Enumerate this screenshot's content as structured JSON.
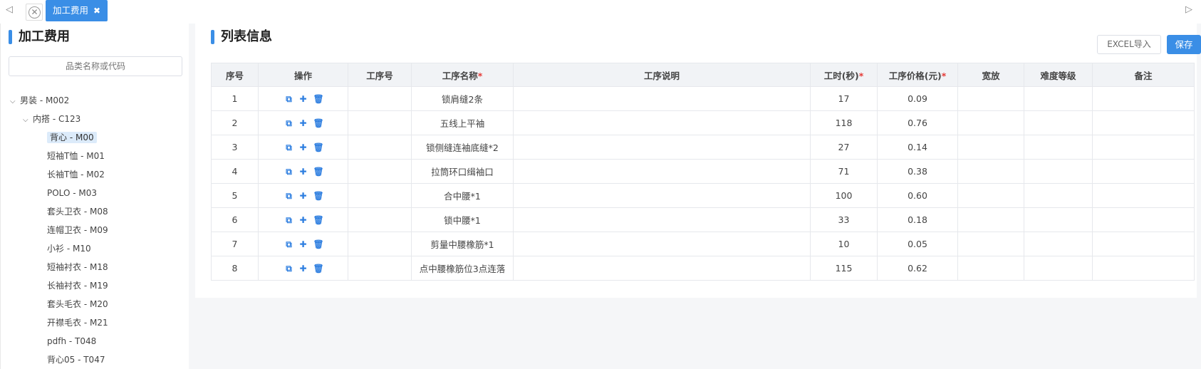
{
  "tabbar": {
    "active_tab_label": "加工费用",
    "active_tab_close": "✖",
    "close_all_glyph": "✕",
    "nav_left_glyph": "◁",
    "nav_right_glyph": "▷"
  },
  "left": {
    "title": "加工费用",
    "search_placeholder": "品类名称或代码",
    "tree": [
      {
        "label": "男装 - M002",
        "level": 0,
        "expanded": true
      },
      {
        "label": "内搭 - C123",
        "level": 1,
        "expanded": true
      },
      {
        "label": "背心 - M00",
        "level": 2,
        "selected": true
      },
      {
        "label": "短袖T恤 - M01",
        "level": 2
      },
      {
        "label": "长袖T恤 - M02",
        "level": 2
      },
      {
        "label": "POLO - M03",
        "level": 2
      },
      {
        "label": "套头卫衣 - M08",
        "level": 2
      },
      {
        "label": "连帽卫衣 - M09",
        "level": 2
      },
      {
        "label": "小衫 - M10",
        "level": 2
      },
      {
        "label": "短袖衬衣 - M18",
        "level": 2
      },
      {
        "label": "长袖衬衣 - M19",
        "level": 2
      },
      {
        "label": "套头毛衣 - M20",
        "level": 2
      },
      {
        "label": "开襟毛衣 - M21",
        "level": 2
      },
      {
        "label": "pdfh - T048",
        "level": 2
      },
      {
        "label": "背心05 - T047",
        "level": 2
      }
    ]
  },
  "main": {
    "title": "列表信息",
    "excel_import_label": "EXCEL导入",
    "save_label": "保存",
    "columns": [
      {
        "label": "序号",
        "required": false
      },
      {
        "label": "操作",
        "required": false
      },
      {
        "label": "工序号",
        "required": false
      },
      {
        "label": "工序名称",
        "required": true
      },
      {
        "label": "工序说明",
        "required": false
      },
      {
        "label": "工时(秒)",
        "required": true
      },
      {
        "label": "工序价格(元)",
        "required": true
      },
      {
        "label": "宽放",
        "required": false
      },
      {
        "label": "难度等级",
        "required": false
      },
      {
        "label": "备注",
        "required": false
      }
    ],
    "required_mark": "*",
    "rows": [
      {
        "no": "1",
        "process_no": "",
        "name": "锁肩缝2条",
        "desc": "",
        "seconds": "17",
        "price": "0.09",
        "allowance": "",
        "level": "",
        "note": ""
      },
      {
        "no": "2",
        "process_no": "",
        "name": "五线上平袖",
        "desc": "",
        "seconds": "118",
        "price": "0.76",
        "allowance": "",
        "level": "",
        "note": ""
      },
      {
        "no": "3",
        "process_no": "",
        "name": "锁侧缝连袖底缝*2",
        "desc": "",
        "seconds": "27",
        "price": "0.14",
        "allowance": "",
        "level": "",
        "note": ""
      },
      {
        "no": "4",
        "process_no": "",
        "name": "拉筒环口缉袖口",
        "desc": "",
        "seconds": "71",
        "price": "0.38",
        "allowance": "",
        "level": "",
        "note": ""
      },
      {
        "no": "5",
        "process_no": "",
        "name": "合中腰*1",
        "desc": "",
        "seconds": "100",
        "price": "0.60",
        "allowance": "",
        "level": "",
        "note": ""
      },
      {
        "no": "6",
        "process_no": "",
        "name": "锁中腰*1",
        "desc": "",
        "seconds": "33",
        "price": "0.18",
        "allowance": "",
        "level": "",
        "note": ""
      },
      {
        "no": "7",
        "process_no": "",
        "name": "剪量中腰橡筋*1",
        "desc": "",
        "seconds": "10",
        "price": "0.05",
        "allowance": "",
        "level": "",
        "note": ""
      },
      {
        "no": "8",
        "process_no": "",
        "name": "点中腰橡筋位3点连落",
        "desc": "",
        "seconds": "115",
        "price": "0.62",
        "allowance": "",
        "level": "",
        "note": ""
      }
    ],
    "row_actions": [
      {
        "icon": "copy-icon",
        "glyph": "⧉"
      },
      {
        "icon": "add-icon",
        "glyph": "✚"
      },
      {
        "icon": "delete-icon",
        "glyph": "🗑"
      }
    ]
  },
  "colors": {
    "accent": "#3a8ee6",
    "required": "#e53935",
    "selected_bg": "#dcebfa"
  }
}
